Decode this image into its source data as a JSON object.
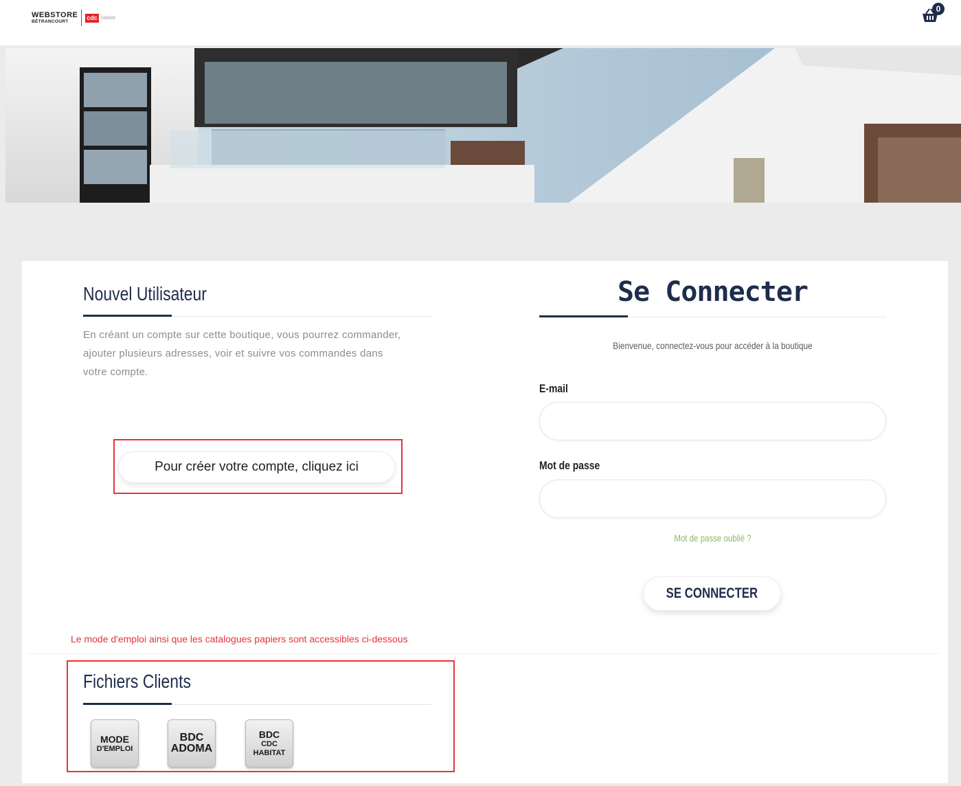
{
  "header": {
    "logo_line1": "WEBSTORE",
    "logo_line2": "BÉTRANCOURT",
    "partner_logo_box": "cdc",
    "partner_logo_text": "habitat",
    "cart_count": "0"
  },
  "new_user": {
    "title": "Nouvel Utilisateur",
    "description": "En créant un compte sur cette boutique, vous pourrez commander, ajouter plusieurs adresses, voir et suivre vos commandes dans votre compte.",
    "create_button": "Pour créer votre compte, cliquez ici"
  },
  "login": {
    "title": "Se Connecter",
    "welcome": "Bienvenue, connectez-vous pour accéder à la boutique",
    "email_label": "E-mail",
    "email_value": "",
    "password_label": "Mot de passe",
    "password_value": "",
    "forgot_link": "Mot de passe oublié ?",
    "submit_button": "SE CONNECTER"
  },
  "notice": "Le mode d'emploi ainsi que les catalogues papiers sont accessibles ci-dessous",
  "files": {
    "title": "Fichiers Clients",
    "tiles": [
      {
        "line1": "MODE",
        "line2": "D'EMPLOI"
      },
      {
        "line1": "BDC",
        "line2": "ADOMA"
      },
      {
        "line1": "BDC",
        "line2": "CDC",
        "line3": "HABITAT"
      }
    ]
  },
  "colors": {
    "brand_navy": "#1f2d4b",
    "highlight_red": "#e8323a",
    "link_green": "#8fb66c",
    "page_bg": "#ebebeb"
  },
  "icons": {
    "cart": "basket-icon"
  }
}
